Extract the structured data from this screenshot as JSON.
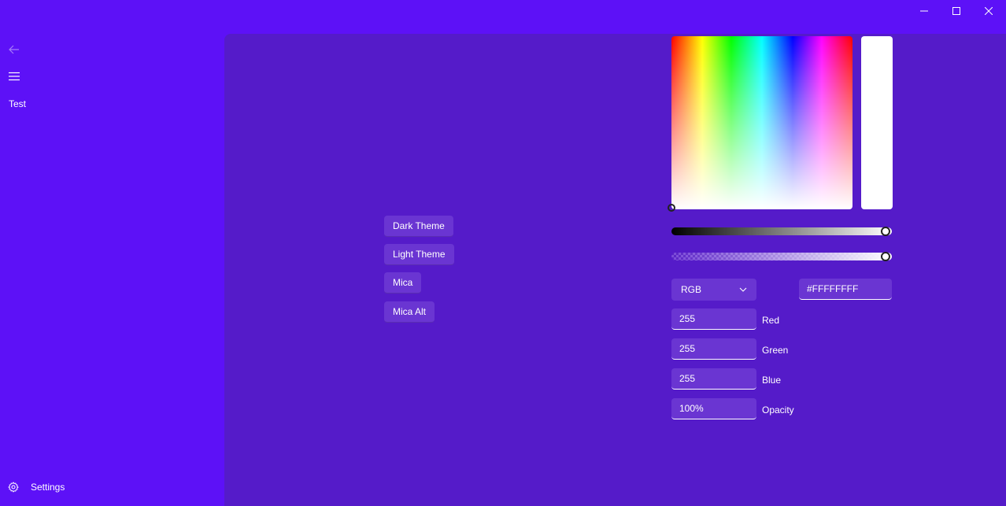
{
  "navigation": {
    "back_icon": "back-arrow-icon",
    "menu_icon": "hamburger-menu-icon",
    "items": [
      {
        "label": "Test"
      }
    ],
    "settings": {
      "label": "Settings",
      "icon": "gear-icon"
    }
  },
  "titlebar": {
    "minimize_icon": "minimize-icon",
    "maximize_icon": "maximize-icon",
    "close_icon": "close-icon"
  },
  "theme_buttons": [
    {
      "label": "Dark Theme"
    },
    {
      "label": "Light Theme"
    },
    {
      "label": "Mica"
    },
    {
      "label": "Mica Alt"
    }
  ],
  "color_picker": {
    "mode": "RGB",
    "hex": "#FFFFFFFF",
    "value_level": 1.0,
    "alpha_level": 1.0,
    "preview_color": "#FFFFFF",
    "fields": [
      {
        "value": "255",
        "label": "Red"
      },
      {
        "value": "255",
        "label": "Green"
      },
      {
        "value": "255",
        "label": "Blue"
      },
      {
        "value": "100%",
        "label": "Opacity"
      }
    ]
  },
  "colors": {
    "window_background": "#5d11f7",
    "content_background": "#551bc9",
    "control_background": "#6a35d2"
  }
}
